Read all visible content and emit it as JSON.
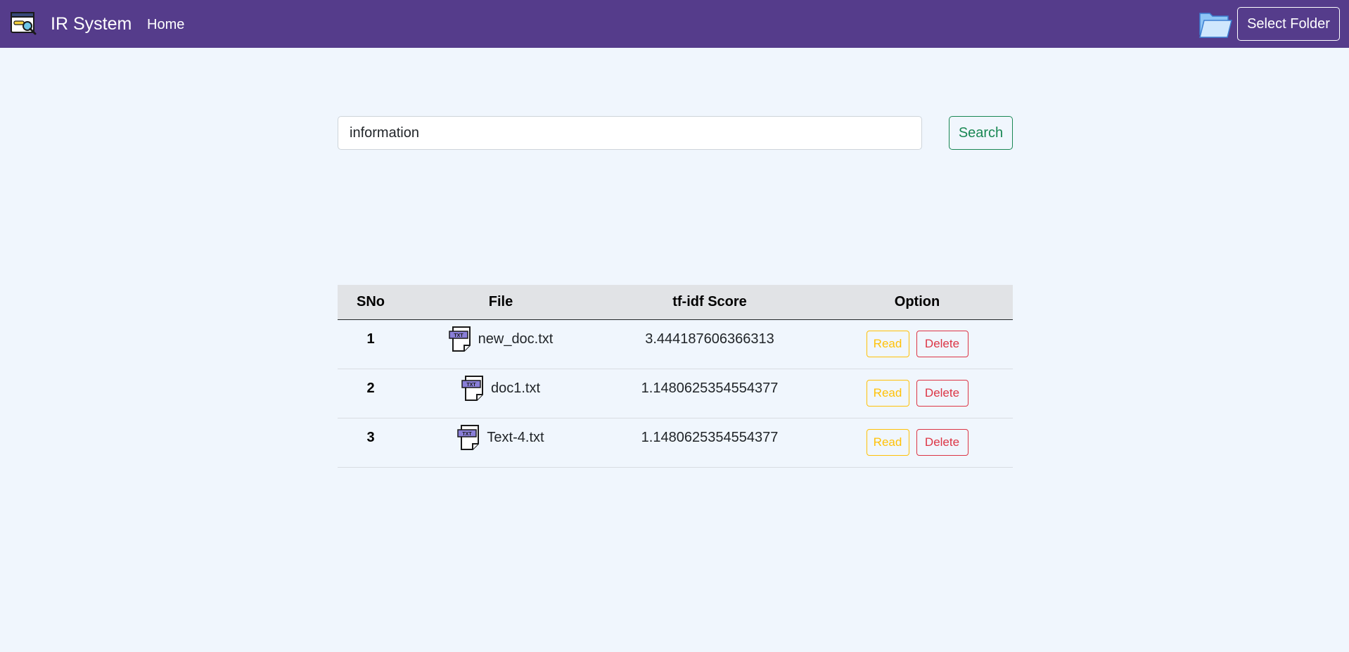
{
  "navbar": {
    "brand": "IR System",
    "home_label": "Home",
    "select_folder_label": "Select Folder",
    "background_color": "#553c8b",
    "logo_icon": "search-window-icon",
    "folder_icon": "open-folder-icon"
  },
  "search": {
    "value": "information",
    "button_label": "Search"
  },
  "table": {
    "headers": [
      "SNo",
      "File",
      "tf-idf Score",
      "Option"
    ],
    "rows": [
      {
        "sno": "1",
        "file": "new_doc.txt",
        "score": "3.444187606366313",
        "read_label": "Read",
        "delete_label": "Delete",
        "file_icon": "txt-file-icon"
      },
      {
        "sno": "2",
        "file": "doc1.txt",
        "score": "1.1480625354554377",
        "read_label": "Read",
        "delete_label": "Delete",
        "file_icon": "txt-file-icon"
      },
      {
        "sno": "3",
        "file": "Text-4.txt",
        "score": "1.1480625354554377",
        "read_label": "Read",
        "delete_label": "Delete",
        "file_icon": "txt-file-icon"
      }
    ],
    "txt_badge": "TXT"
  },
  "colors": {
    "read": "#ffc107",
    "delete": "#dc3545",
    "search": "#198754",
    "page_bg": "#f0f6fd"
  }
}
